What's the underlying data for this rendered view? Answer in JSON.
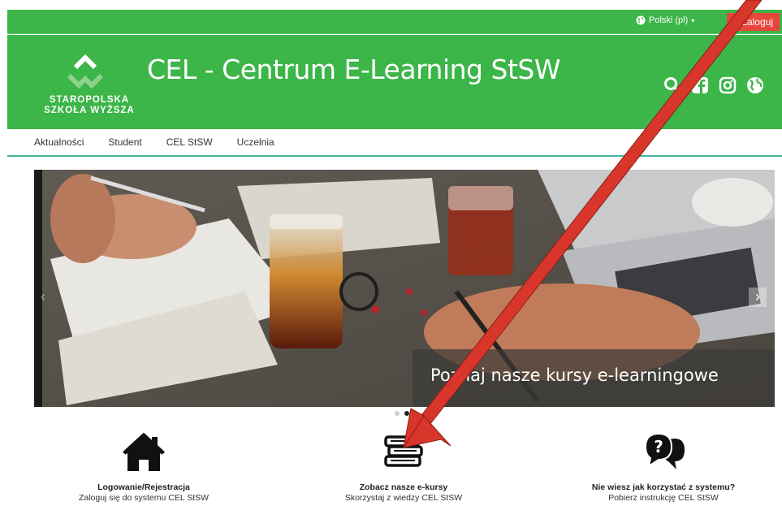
{
  "topbar": {
    "language_label": "Polski (pl)",
    "login_label": "Zaloguj"
  },
  "header": {
    "logo": {
      "line1": "STAROPOLSKA",
      "line2": "SZKOŁA WYŻSZA"
    },
    "title": "CEL - Centrum E-Learning StSW",
    "icons": [
      "search-icon",
      "facebook-icon",
      "instagram-icon",
      "globe-icon"
    ]
  },
  "nav": {
    "items": [
      {
        "label": "Aktualności"
      },
      {
        "label": "Student"
      },
      {
        "label": "CEL StSW"
      },
      {
        "label": "Uczelnia"
      }
    ]
  },
  "slider": {
    "caption": "Poznaj nasze kursy e-learningowe",
    "dot_count": 2,
    "active_dot": 1
  },
  "features": [
    {
      "icon": "home-icon",
      "title": "Logowanie/Rejestracja",
      "subtitle": "Zaloguj się do systemu CEL StSW"
    },
    {
      "icon": "books-icon",
      "title": "Zobacz nasze e-kursy",
      "subtitle": "Skorzystaj z wiedzy CEL StSW"
    },
    {
      "icon": "help-chat-icon",
      "title": "Nie wiesz jak korzystać z systemu?",
      "subtitle": "Pobierz instrukcję CEL StSW"
    }
  ],
  "colors": {
    "brand_green": "#3cb549",
    "login_red": "#e8453c",
    "nav_underline": "#44b89c",
    "annotation_arrow": "#d9362b"
  }
}
